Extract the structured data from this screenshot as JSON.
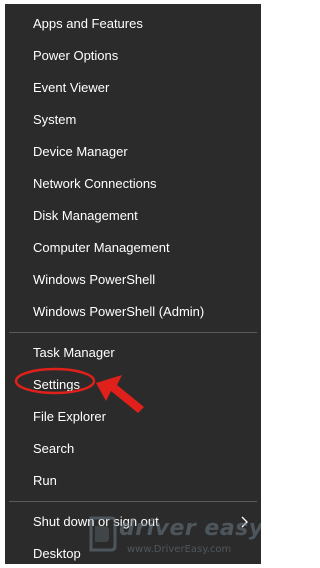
{
  "menu": {
    "items": [
      {
        "label": "Apps and Features"
      },
      {
        "label": "Power Options"
      },
      {
        "label": "Event Viewer"
      },
      {
        "label": "System"
      },
      {
        "label": "Device Manager"
      },
      {
        "label": "Network Connections"
      },
      {
        "label": "Disk Management"
      },
      {
        "label": "Computer Management"
      },
      {
        "label": "Windows PowerShell"
      },
      {
        "label": "Windows PowerShell (Admin)"
      },
      {
        "label": "Task Manager"
      },
      {
        "label": "Settings"
      },
      {
        "label": "File Explorer"
      },
      {
        "label": "Search"
      },
      {
        "label": "Run"
      },
      {
        "label": "Shut down or sign out"
      },
      {
        "label": "Desktop"
      }
    ],
    "submenu_icon": "chevron-right-icon"
  },
  "annotation": {
    "highlight_color": "#e0201b",
    "highlighted_item": "Settings"
  },
  "watermark": {
    "brand": "driver easy",
    "url": "www.DriverEasy.com"
  },
  "colors": {
    "menu_background": "#2b2b2b",
    "text": "#ffffff",
    "separator": "#5a5a5a"
  }
}
